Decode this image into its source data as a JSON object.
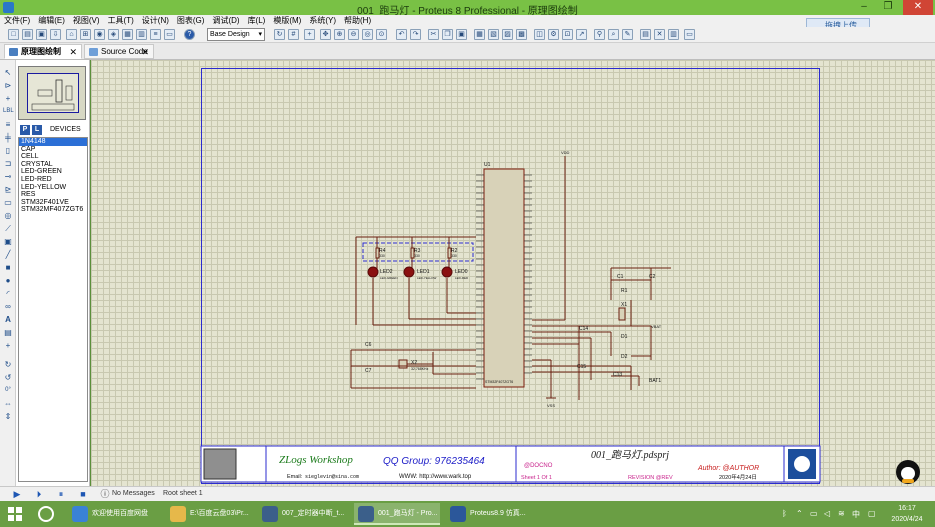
{
  "window": {
    "title": "001_跑马灯 - Proteus 8 Professional - 原理图绘制",
    "minimize": "–",
    "restore": "❐",
    "close": "✕"
  },
  "menu": [
    "文件(F)",
    "编辑(E)",
    "视图(V)",
    "工具(T)",
    "设计(N)",
    "图表(G)",
    "调试(D)",
    "库(L)",
    "模版(M)",
    "系统(Y)",
    "帮助(H)"
  ],
  "toolbar": {
    "design_select": "Base Design",
    "upload_label": "拖拽上传"
  },
  "tabs": [
    {
      "label": "原理图绘制",
      "close": "✕"
    },
    {
      "label": "Source Code",
      "close": "✕"
    }
  ],
  "devices_panel": {
    "p_label": "P",
    "l_label": "L",
    "title": "DEVICES",
    "items": [
      "1N4148",
      "CAP",
      "CELL",
      "CRYSTAL",
      "LED-GREEN",
      "LED-RED",
      "LED-YELLOW",
      "RES",
      "STM32F401VE",
      "STM32MF407ZGT6"
    ],
    "selected_index": 0
  },
  "rotation_value": "0°",
  "schematic": {
    "mcu_label": "U1",
    "mcu_part": "STM32F407ZGT6",
    "resistors": [
      "R4",
      "R3",
      "R2",
      "R1"
    ],
    "resistor_value": "330",
    "leds": [
      "LED2",
      "LED1",
      "LED0"
    ],
    "led_parts": [
      "LED-GREEN",
      "LED-YELLOW",
      "LED-RED"
    ],
    "caps": [
      "C1",
      "C2",
      "C6",
      "C7",
      "C14",
      "C15",
      "C13"
    ],
    "crystals": [
      "X1",
      "X2"
    ],
    "x2_value": "32.768KHz",
    "diodes": [
      "D1",
      "D2"
    ],
    "battery": "BAT1",
    "vdd": "VDD",
    "vss": "VSS",
    "vbat": "VBAT"
  },
  "title_block": {
    "brand": "ZLogs Workshop",
    "qq": "QQ Group: 976235464",
    "email_label": "Email:",
    "email": "sieglevin@sina.com",
    "www": "WWW: http://www.wark.top",
    "project": "001_跑马灯.pdsprj",
    "docno": "@DOCNO",
    "sheet": "Sheet 1 Of 1",
    "revision": "REVISION @REV",
    "author": "Author: @AUTHOR",
    "date": "2020年4月24日"
  },
  "status": {
    "messages": "No Messages",
    "sheet": "Root sheet 1"
  },
  "taskbar": {
    "tasks": [
      "欢迎使用百度网盘",
      "E:\\百度云盘03\\Pr...",
      "007_定时器中断_t...",
      "001_跑马灯 - Pro...",
      "Proteus8.9 仿真..."
    ],
    "active_index": 3,
    "time": "16:17",
    "date": "2020/4/24"
  }
}
